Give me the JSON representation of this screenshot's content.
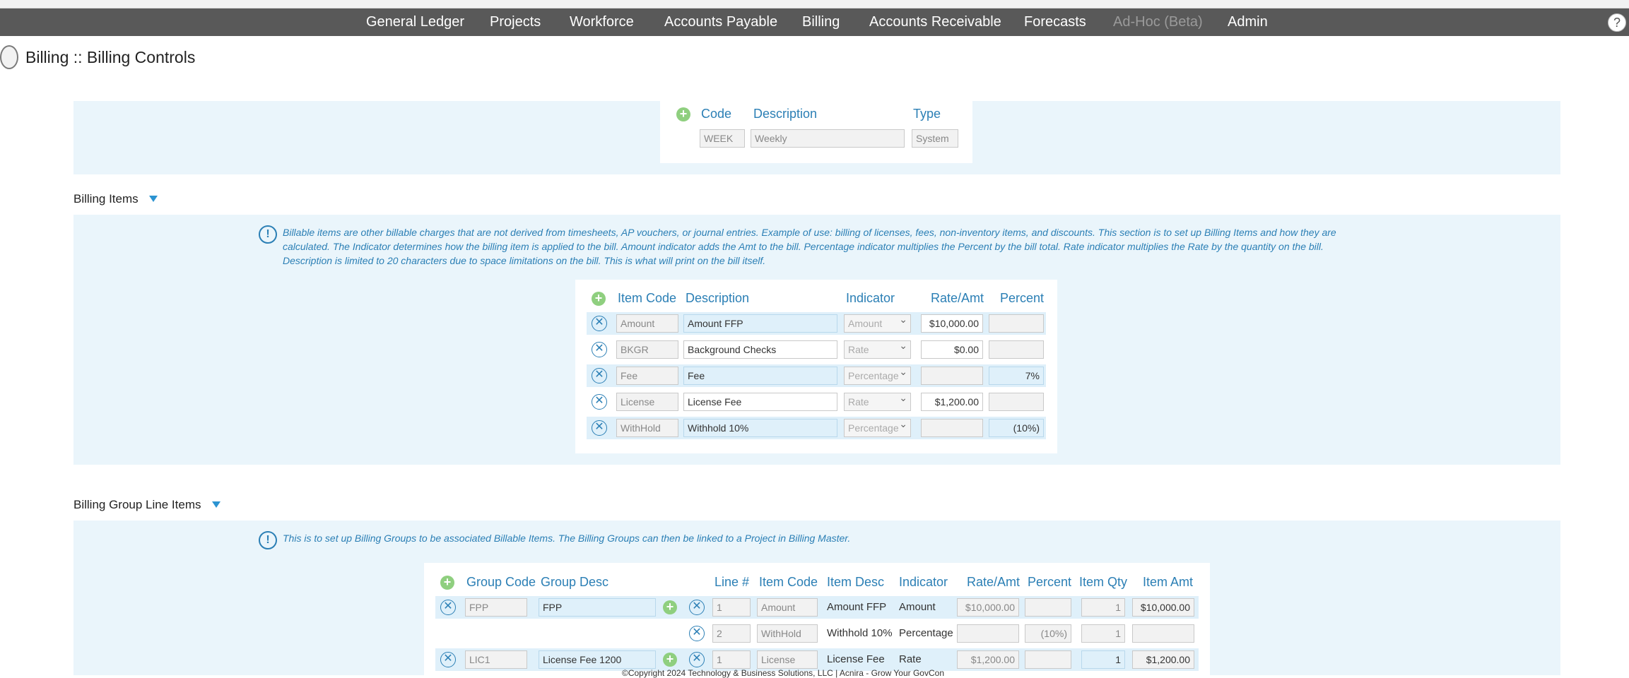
{
  "nav": {
    "items": [
      {
        "label": "General Ledger",
        "disabled": false
      },
      {
        "label": "Projects",
        "disabled": false
      },
      {
        "label": "Workforce",
        "disabled": false
      },
      {
        "label": "Accounts Payable",
        "disabled": false
      },
      {
        "label": "Billing",
        "disabled": false
      },
      {
        "label": "Accounts Receivable",
        "disabled": false
      },
      {
        "label": "Forecasts",
        "disabled": false
      },
      {
        "label": "Ad-Hoc (Beta)",
        "disabled": true
      },
      {
        "label": "Admin",
        "disabled": false
      }
    ],
    "help_label": "?"
  },
  "page": {
    "title": "Billing :: Billing Controls"
  },
  "frequency": {
    "headers": {
      "code": "Code",
      "description": "Description",
      "type": "Type"
    },
    "row": {
      "code": "WEEK",
      "description": "Weekly",
      "type": "System"
    }
  },
  "billing_items": {
    "label": "Billing Items",
    "info": "Billable items are other billable charges that are not derived from timesheets, AP vouchers, or journal entries. Example of use: billing of licenses, fees, non-inventory items, and discounts. This section is to set up Billing Items and how they are calculated. The Indicator determines how the billing item is applied to the bill. Amount indicator adds the Amt to the bill. Percentage indicator multiplies the Percent by the bill total. Rate indicator multiplies the Rate by the quantity on the bill. Description is limited to 20 characters due to space limitations on the bill. This is what will print on the bill itself.",
    "headers": {
      "item_code": "Item Code",
      "description": "Description",
      "indicator": "Indicator",
      "rate_amt": "Rate/Amt",
      "percent": "Percent"
    },
    "rows": [
      {
        "code": "Amount",
        "description": "Amount FFP",
        "indicator": "Amount",
        "rate_amt": "$10,000.00",
        "percent": ""
      },
      {
        "code": "BKGR",
        "description": "Background Checks",
        "indicator": "Rate",
        "rate_amt": "$0.00",
        "percent": ""
      },
      {
        "code": "Fee",
        "description": "Fee",
        "indicator": "Percentage",
        "rate_amt": "",
        "percent": "7%"
      },
      {
        "code": "License",
        "description": "License Fee",
        "indicator": "Rate",
        "rate_amt": "$1,200.00",
        "percent": ""
      },
      {
        "code": "WithHold",
        "description": "Withhold 10%",
        "indicator": "Percentage",
        "rate_amt": "",
        "percent": "(10%)"
      }
    ]
  },
  "group_items": {
    "label": "Billing Group Line Items",
    "info": "This is to set up Billing Groups to be associated Billable Items. The Billing Groups can then be linked to a Project in Billing Master.",
    "headers": {
      "group_code": "Group Code",
      "group_desc": "Group Desc",
      "line": "Line #",
      "item_code": "Item Code",
      "item_desc": "Item Desc",
      "indicator": "Indicator",
      "rate_amt": "Rate/Amt",
      "percent": "Percent",
      "item_qty": "Item Qty",
      "item_amt": "Item Amt"
    },
    "rows": [
      {
        "group_code": "FPP",
        "group_desc": "FPP",
        "line": "1",
        "item_code": "Amount",
        "item_desc": "Amount FFP",
        "indicator": "Amount",
        "rate_amt": "$10,000.00",
        "percent": "",
        "item_qty": "1",
        "item_amt": "$10,000.00"
      },
      {
        "group_code": "",
        "group_desc": "",
        "line": "2",
        "item_code": "WithHold",
        "item_desc": "Withhold 10%",
        "indicator": "Percentage",
        "rate_amt": "",
        "percent": "(10%)",
        "item_qty": "1",
        "item_amt": ""
      },
      {
        "group_code": "LIC1",
        "group_desc": "License Fee 1200",
        "line": "1",
        "item_code": "License",
        "item_desc": "License Fee",
        "indicator": "Rate",
        "rate_amt": "$1,200.00",
        "percent": "",
        "item_qty": "1",
        "item_amt": "$1,200.00"
      }
    ]
  },
  "footer": {
    "text": "©Copyright 2024 Technology & Business Solutions, LLC  |  Acnira - Grow Your GovCon"
  },
  "colors": {
    "nav_bg": "#595959",
    "accent": "#2b7fb5",
    "panel_bg": "#eaf5fb",
    "add_green": "#8fcf7f"
  }
}
